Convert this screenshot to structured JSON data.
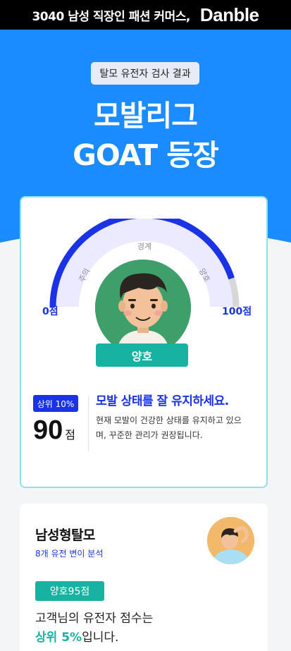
{
  "banner": {
    "tagline": "3040 남성 직장인 패션 커머스,",
    "brand": "Danble"
  },
  "hero": {
    "badge": "탈모 유전자 검사 결과",
    "title_line1": "모발리그",
    "title_line2": "GOAT 등장"
  },
  "result": {
    "gauge": {
      "min_label": "0점",
      "max_label": "100점",
      "zones": [
        "주의",
        "경계",
        "양호"
      ],
      "score_fraction": 0.9
    },
    "status": "양호",
    "rank_badge": "상위 10%",
    "score_value": "90",
    "score_unit": "점",
    "headline": "모발 상태를 잘 유지하세요.",
    "description": "현재 모발이 건강한 상태를 유지하고 있으며, 꾸준한 관리가 권장됩니다."
  },
  "trait": {
    "title": "남성형탈모",
    "subtitle": "8개 유전 변이 분석",
    "pill_status": "양호",
    "pill_score": "95점",
    "desc_line1": "고객님의 유전자 점수는",
    "desc_highlight": "상위 5%",
    "desc_suffix": "입니다."
  },
  "colors": {
    "brand_blue": "#1a8cff",
    "gauge_blue": "#1a33e6",
    "teal": "#16b3a2",
    "card_border": "#8fdff0"
  }
}
